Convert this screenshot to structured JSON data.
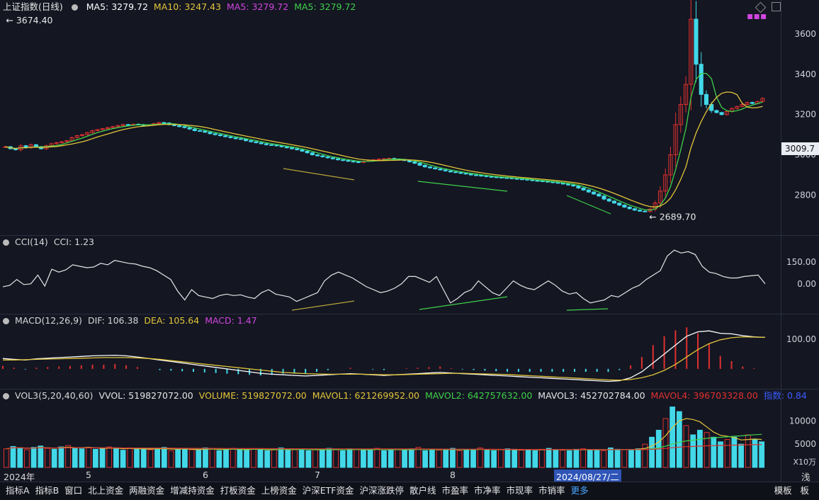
{
  "header": {
    "title": "上证指数(日线)",
    "ma_items": [
      {
        "label": "MA5: 3279.72",
        "color": "#ffffff"
      },
      {
        "label": "MA10: 3247.43",
        "color": "#e2c53a"
      },
      {
        "label": "MA5: 3279.72",
        "color": "#d146e0"
      },
      {
        "label": "MA5: 3279.72",
        "color": "#3fd14a"
      }
    ]
  },
  "price_axis": {
    "labels": [
      "3600",
      "3400",
      "3200",
      "3000",
      "2800"
    ],
    "current_tag": "3009.7"
  },
  "annotations": {
    "high": "3674.40",
    "low": "2689.70"
  },
  "cci": {
    "title": "CCI(14)",
    "value_label": "CCI: 1.23",
    "axis_labels": [
      "150.00",
      "0.00"
    ]
  },
  "macd": {
    "title": "MACD(12,26,9)",
    "dif_label": "DIF: 106.38",
    "dea_label": "DEA: 105.64",
    "macd_label": "MACD: 1.47",
    "axis_labels": [
      "100.00"
    ]
  },
  "vol": {
    "title": "VOL3(5,20,40,60)",
    "items": [
      {
        "label": "VVOL: 519827072.00",
        "color": "#e6e6e6"
      },
      {
        "label": "VOLUME: 519827072.00",
        "color": "#e2c53a"
      },
      {
        "label": "MAVOL1: 621269952.00",
        "color": "#e2c53a"
      },
      {
        "label": "MAVOL2: 642757632.00",
        "color": "#3fd14a"
      },
      {
        "label": "MAVOL3: 452702784.00",
        "color": "#e6e6e6"
      },
      {
        "label": "MAVOL4: 396703328.00",
        "color": "#e0312f"
      },
      {
        "label": "指数: 0.84",
        "color": "#3a5cff"
      }
    ],
    "axis_labels": [
      "10000",
      "5000"
    ],
    "unit": "X10万"
  },
  "date_axis": {
    "labels": [
      "2024年",
      "5",
      "6",
      "7",
      "8"
    ],
    "cursor_date": "2024/08/27/二",
    "right_text": "浅"
  },
  "tabs": [
    "指标A",
    "指标B",
    "窗口",
    "北上资金",
    "两融资金",
    "增减持资金",
    "打板资金",
    "上榜资金",
    "沪深ETF资金",
    "沪深涨跌停",
    "散户线",
    "市盈率",
    "市净率",
    "市现率",
    "市销率",
    "更多"
  ],
  "tabs_right": [
    "模板",
    "板"
  ],
  "colors": {
    "up": "#e0312f",
    "down": "#42d8e8",
    "ma5": "#ffffff",
    "ma10": "#e2c53a",
    "ma_green": "#3fd14a",
    "bg": "#141622"
  },
  "chart_data": {
    "type": "candlestick",
    "x_start_label": "2024年",
    "month_ticks": [
      "5",
      "6",
      "7",
      "8"
    ],
    "close": [
      3040,
      3030,
      3025,
      3045,
      3035,
      3050,
      3040,
      3030,
      3045,
      3055,
      3060,
      3065,
      3070,
      3085,
      3095,
      3100,
      3110,
      3120,
      3125,
      3130,
      3135,
      3140,
      3145,
      3150,
      3148,
      3152,
      3150,
      3145,
      3148,
      3155,
      3160,
      3158,
      3150,
      3145,
      3140,
      3135,
      3128,
      3120,
      3118,
      3112,
      3105,
      3100,
      3095,
      3090,
      3085,
      3080,
      3078,
      3070,
      3065,
      3060,
      3055,
      3050,
      3048,
      3045,
      3040,
      3035,
      3030,
      3025,
      3018,
      3010,
      3000,
      2995,
      2990,
      2985,
      2980,
      2975,
      2972,
      2968,
      2965,
      2962,
      2968,
      2972,
      2975,
      2978,
      2980,
      2982,
      2978,
      2975,
      2972,
      2965,
      2958,
      2948,
      2940,
      2935,
      2930,
      2925,
      2920,
      2915,
      2912,
      2908,
      2905,
      2900,
      2898,
      2895,
      2892,
      2890,
      2888,
      2886,
      2885,
      2882,
      2880,
      2878,
      2875,
      2872,
      2870,
      2868,
      2865,
      2862,
      2860,
      2855,
      2850,
      2845,
      2835,
      2825,
      2815,
      2805,
      2795,
      2780,
      2770,
      2760,
      2750,
      2740,
      2732,
      2725,
      2720,
      2718,
      2730,
      2760,
      2820,
      2900,
      3000,
      3150,
      3250,
      3350,
      3674,
      3450,
      3300,
      3250,
      3220,
      3210,
      3200,
      3215,
      3230,
      3240,
      3250,
      3260,
      3255,
      3265,
      3280
    ],
    "high": 3674.4,
    "low": 2689.7,
    "y_range": [
      2650,
      3720
    ],
    "cci": [
      -20,
      -10,
      30,
      -5,
      0,
      60,
      -15,
      100,
      80,
      95,
      130,
      120,
      110,
      115,
      140,
      130,
      160,
      150,
      140,
      135,
      120,
      110,
      90,
      60,
      30,
      -50,
      -110,
      -40,
      -80,
      -90,
      -100,
      -80,
      -70,
      -80,
      -75,
      -90,
      -100,
      -60,
      -40,
      -70,
      -80,
      -90,
      -120,
      -100,
      -80,
      -60,
      20,
      60,
      80,
      60,
      40,
      10,
      -20,
      -40,
      -60,
      -50,
      -30,
      0,
      50,
      50,
      30,
      10,
      50,
      -40,
      -130,
      -100,
      -60,
      -40,
      20,
      -20,
      -60,
      -80,
      -30,
      20,
      -10,
      -30,
      -40,
      -10,
      20,
      -10,
      -50,
      -70,
      -60,
      -100,
      -130,
      -120,
      -110,
      -80,
      -90,
      -60,
      -30,
      -10,
      30,
      60,
      90,
      190,
      230,
      210,
      220,
      200,
      120,
      80,
      70,
      50,
      40,
      40,
      50,
      55,
      60,
      0
    ],
    "cci_range": [
      -180,
      260
    ],
    "dif": [
      35,
      32,
      30,
      34,
      36,
      38,
      40,
      42,
      44,
      45,
      46,
      44,
      40,
      35,
      30,
      25,
      20,
      15,
      10,
      5,
      0,
      -5,
      -10,
      -15,
      -18,
      -20,
      -22,
      -24,
      -22,
      -20,
      -18,
      -16,
      -18,
      -20,
      -22,
      -20,
      -18,
      -16,
      -14,
      -12,
      -14,
      -16,
      -18,
      -20,
      -22,
      -24,
      -26,
      -28,
      -30,
      -32,
      -34,
      -36,
      -38,
      -40,
      -42,
      -40,
      -30,
      -10,
      20,
      50,
      80,
      110,
      125,
      128,
      120,
      118,
      112,
      108,
      106
    ],
    "dea": [
      30,
      30,
      31,
      32,
      33,
      34,
      35,
      36,
      37,
      38,
      38,
      38,
      37,
      35,
      32,
      28,
      24,
      20,
      16,
      12,
      8,
      4,
      0,
      -4,
      -8,
      -12,
      -14,
      -16,
      -17,
      -18,
      -18,
      -18,
      -18,
      -19,
      -20,
      -20,
      -19,
      -18,
      -17,
      -16,
      -15,
      -15,
      -16,
      -17,
      -18,
      -19,
      -21,
      -23,
      -25,
      -27,
      -29,
      -31,
      -33,
      -35,
      -37,
      -38,
      -36,
      -30,
      -20,
      -5,
      15,
      40,
      65,
      85,
      98,
      105,
      108,
      107,
      106
    ],
    "macd_range": [
      -60,
      150
    ],
    "volume_axis_max": 14000,
    "volume": [
      4000,
      4500,
      4200,
      3800,
      4300,
      4600,
      4100,
      3900,
      4400,
      4700,
      4200,
      4000,
      4300,
      3900,
      4100,
      4400,
      4000,
      3700,
      4200,
      3900,
      4100,
      3800,
      4000,
      4300,
      3600,
      3900,
      4100,
      3800,
      3700,
      4200,
      4000,
      3600,
      3800,
      4100,
      3900,
      3700,
      4000,
      3800,
      3600,
      3900,
      4200,
      3700,
      3800,
      4000,
      3600,
      3900,
      3700,
      4100,
      3800,
      3600,
      4000,
      3900,
      3700,
      3800,
      4100,
      3600,
      3900,
      3800,
      3700,
      4000,
      4300,
      3600,
      3800,
      3700,
      3900,
      4100,
      3600,
      3800,
      3900,
      4200,
      3700,
      3600,
      3800,
      4000,
      3900,
      3700,
      3800,
      3600,
      3900,
      4100,
      3800,
      3700,
      3600,
      3900,
      4000,
      3800,
      3700,
      3600,
      4200,
      3900,
      3800,
      3700,
      4000,
      5000,
      6500,
      8000,
      10500,
      13000,
      12000,
      9000,
      7000,
      8000,
      7500,
      6500,
      5500,
      6000,
      6500,
      5000,
      7000,
      6000,
      5500
    ]
  }
}
